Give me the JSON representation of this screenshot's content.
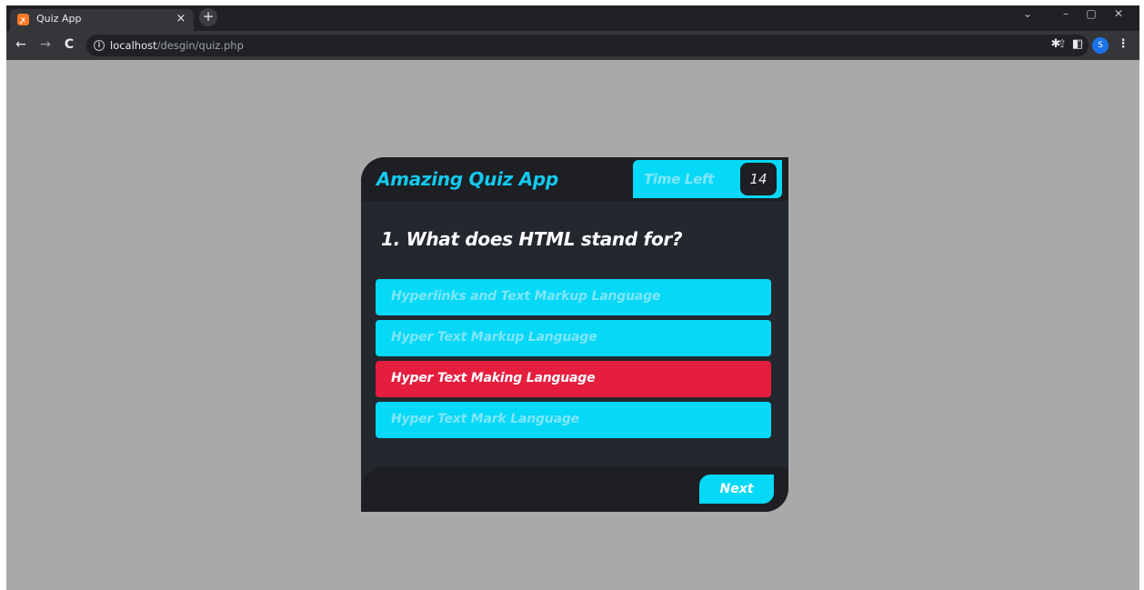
{
  "browser": {
    "tab_title": "Quiz App",
    "tab_close": "×",
    "new_tab": "+",
    "url_host": "localhost",
    "url_path": "/desgin/quiz.php",
    "profile_initial": "S"
  },
  "quiz": {
    "title": "Amazing Quiz App",
    "timer_label": "Time Left",
    "time_left": "14",
    "question": "1. What does HTML stand for?",
    "options": [
      {
        "label": "Hyperlinks and Text Markup Language",
        "state": "default"
      },
      {
        "label": "Hyper Text Markup Language",
        "state": "default"
      },
      {
        "label": "Hyper Text Making Language",
        "state": "wrong"
      },
      {
        "label": "Hyper Text Mark Language",
        "state": "default"
      }
    ],
    "next_label": "Next"
  },
  "colors": {
    "page_bg": "#a9a9a9",
    "card_bg": "#23272e",
    "accent": "#06d8f7",
    "wrong": "#e61e3e",
    "title_text": "#14c9ee"
  }
}
